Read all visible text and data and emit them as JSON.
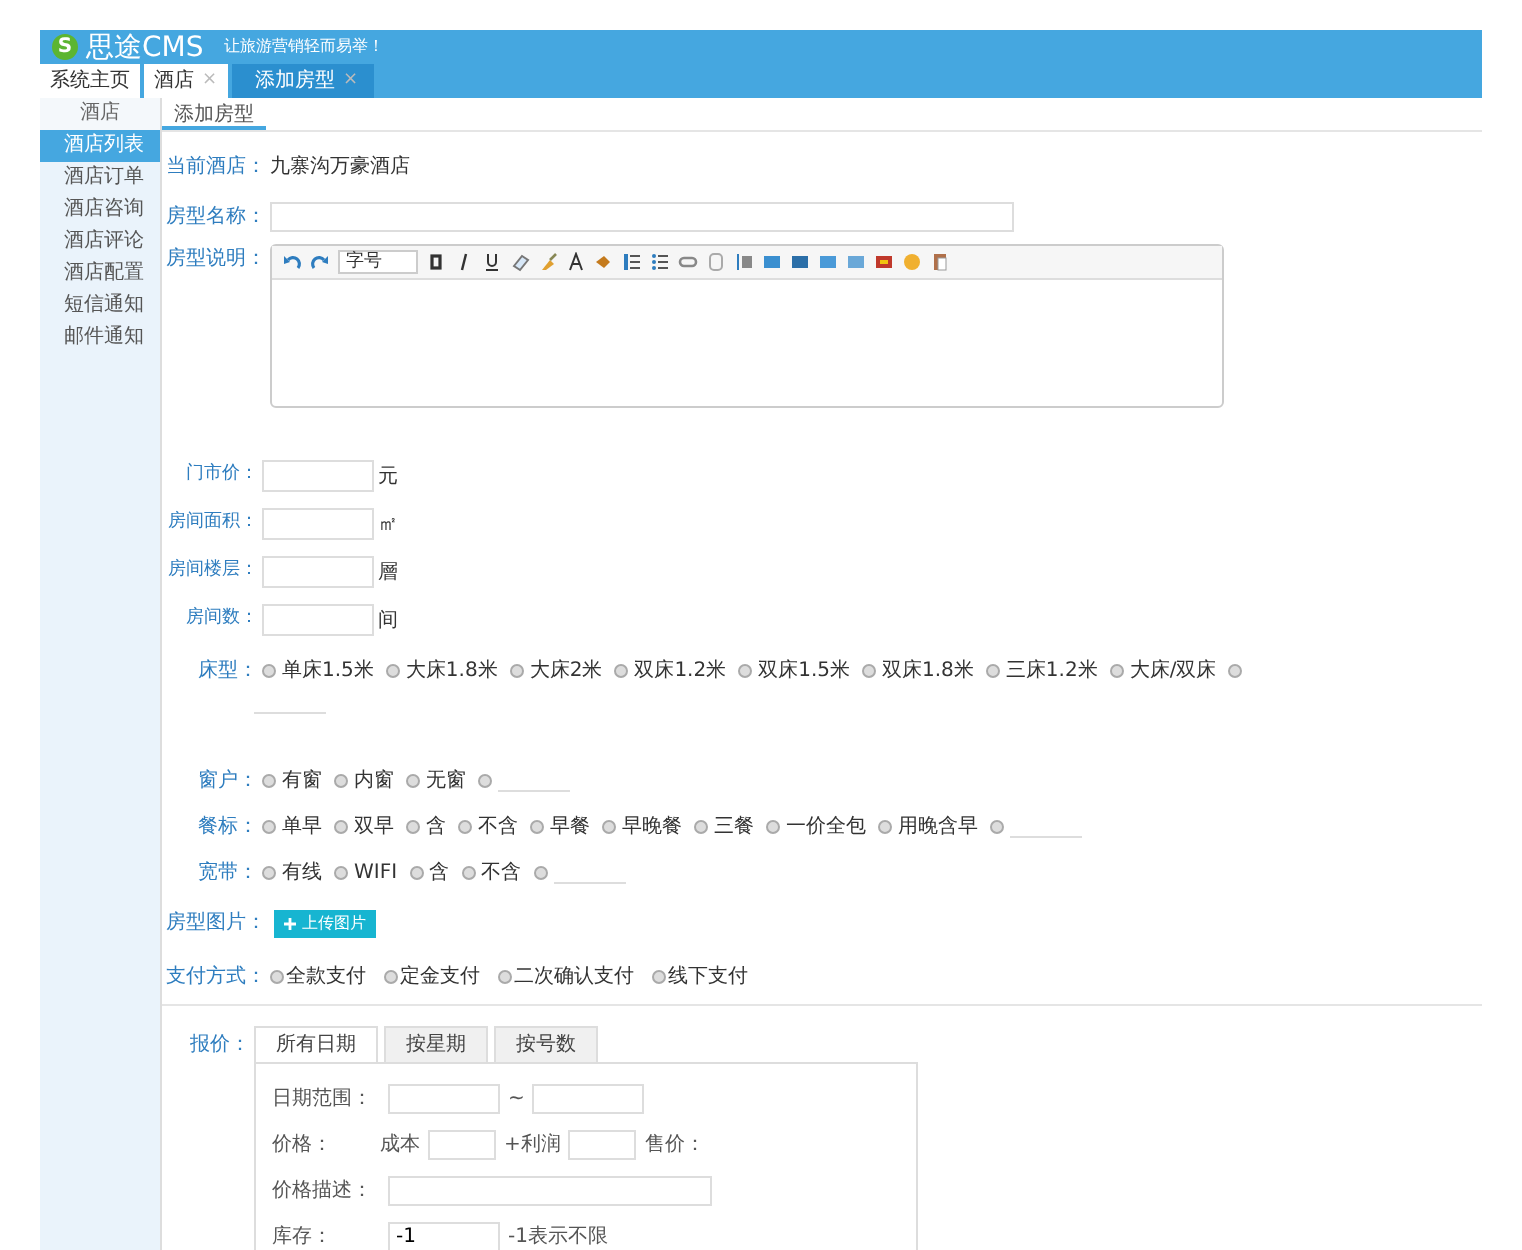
{
  "header": {
    "logo_mark": "S",
    "logo_text": "思途CMS",
    "slogan": "让旅游营销轻而易举！"
  },
  "tabs": [
    {
      "label": "系统主页",
      "closable": false,
      "selected": false
    },
    {
      "label": "酒店",
      "closable": true,
      "selected": false
    },
    {
      "label": "添加房型",
      "closable": true,
      "selected": true
    }
  ],
  "tab_close": "×",
  "sidebar": {
    "title": "酒店",
    "items": [
      {
        "label": "酒店列表",
        "selected": true
      },
      {
        "label": "酒店订单",
        "selected": false
      },
      {
        "label": "酒店咨询",
        "selected": false
      },
      {
        "label": "酒店评论",
        "selected": false
      },
      {
        "label": "酒店配置",
        "selected": false
      },
      {
        "label": "短信通知",
        "selected": false
      },
      {
        "label": "邮件通知",
        "selected": false
      }
    ]
  },
  "subtab": "添加房型",
  "current_hotel": {
    "label": "当前酒店：",
    "value": "九寨沟万豪酒店"
  },
  "room_name": {
    "label": "房型名称："
  },
  "description": {
    "label": "房型说明：",
    "font_size": "字号"
  },
  "unit_fields": [
    {
      "label": "门市价：",
      "unit": "元"
    },
    {
      "label": "房间面积：",
      "unit": "㎡"
    },
    {
      "label": "房间楼层：",
      "unit": "層"
    },
    {
      "label": "房间数：",
      "unit": "间"
    }
  ],
  "radio_groups": [
    {
      "label": "床型：",
      "options": [
        {
          "label": "单床1.5米",
          "selected": false
        },
        {
          "label": "大床1.8米",
          "selected": false
        },
        {
          "label": "大床2米",
          "selected": false
        },
        {
          "label": "双床1.2米",
          "selected": false
        },
        {
          "label": "双床1.5米",
          "selected": false
        },
        {
          "label": "双床1.8米",
          "selected": false
        },
        {
          "label": "三床1.2米",
          "selected": false
        },
        {
          "label": "大床/双床",
          "selected": false
        },
        {
          "kind": "other",
          "selected": false
        }
      ]
    },
    {
      "label": "窗户：",
      "options": [
        {
          "label": "有窗",
          "selected": false
        },
        {
          "label": "内窗",
          "selected": false
        },
        {
          "label": "无窗",
          "selected": false
        },
        {
          "kind": "other",
          "selected": false
        }
      ]
    },
    {
      "label": "餐标：",
      "options": [
        {
          "label": "单早",
          "selected": false
        },
        {
          "label": "双早",
          "selected": false
        },
        {
          "label": "含",
          "selected": false
        },
        {
          "label": "不含",
          "selected": false
        },
        {
          "label": "早餐",
          "selected": false
        },
        {
          "label": "早晚餐",
          "selected": false
        },
        {
          "label": "三餐",
          "selected": false
        },
        {
          "label": "一价全包",
          "selected": false
        },
        {
          "label": "用晚含早",
          "selected": false
        },
        {
          "kind": "other",
          "selected": false
        }
      ]
    },
    {
      "label": "宽带：",
      "options": [
        {
          "label": "有线",
          "selected": false
        },
        {
          "label": "WIFI",
          "selected": false
        },
        {
          "label": "含",
          "selected": false
        },
        {
          "label": "不含",
          "selected": false
        },
        {
          "kind": "other",
          "selected": false
        }
      ]
    }
  ],
  "room_image": {
    "label": "房型图片：",
    "button": "上传图片"
  },
  "payment": {
    "label": "支付方式：",
    "options": [
      {
        "label": "全款支付",
        "selected": false
      },
      {
        "label": "定金支付",
        "selected": false
      },
      {
        "label": "二次确认支付",
        "selected": false
      },
      {
        "label": "线下支付",
        "selected": false
      }
    ]
  },
  "pricing": {
    "label": "报价：",
    "tabs": [
      {
        "label": "所有日期",
        "selected": true
      },
      {
        "label": "按星期",
        "selected": false
      },
      {
        "label": "按号数",
        "selected": false
      }
    ],
    "date_range": {
      "label": "日期范围：",
      "separator": "~"
    },
    "price": {
      "label": "价格：",
      "cost": "成本",
      "profit": "+利润",
      "sale": "售价："
    },
    "price_desc": {
      "label": "价格描述："
    },
    "stock": {
      "label": "库存：",
      "value": "-1",
      "hint": "-1表示不限"
    }
  }
}
